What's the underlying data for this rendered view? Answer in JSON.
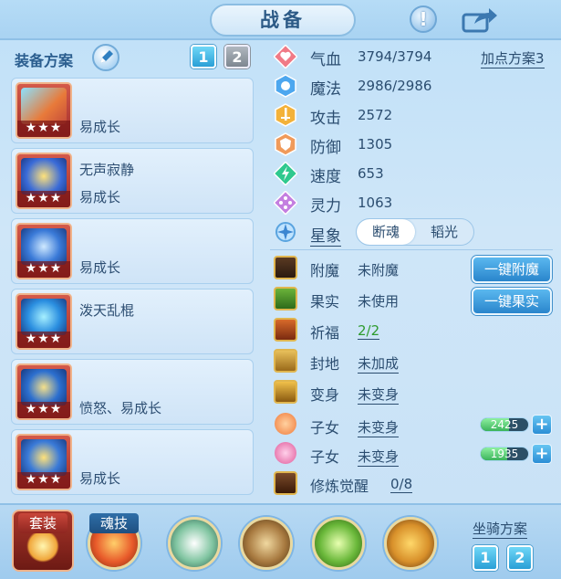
{
  "header": {
    "title": "战备",
    "hint_icon": "exclamation-icon",
    "share_icon": "share-icon"
  },
  "equip_panel": {
    "title": "装备方案",
    "plans": [
      "1",
      "2"
    ],
    "active_plan": "1",
    "items": [
      {
        "name": "",
        "attr": "易成长",
        "stars": "★★★",
        "icon": "ice-sword-icon"
      },
      {
        "name": "无声寂静",
        "attr": "易成长",
        "stars": "★★★",
        "icon": "golden-helmet-icon"
      },
      {
        "name": "",
        "attr": "易成长",
        "stars": "★★★",
        "icon": "blue-armor-icon"
      },
      {
        "name": "泼天乱棍",
        "attr": "",
        "stars": "★★★",
        "icon": "blue-staff-icon"
      },
      {
        "name": "",
        "attr": "愤怒、易成长",
        "stars": "★★★",
        "icon": "blue-necklace-icon"
      },
      {
        "name": "",
        "attr": "易成长",
        "stars": "★★★",
        "icon": "gold-boots-icon"
      }
    ]
  },
  "stats": {
    "add_point_plan": "加点方案3",
    "rows": [
      {
        "label": "气血",
        "value": "3794/3794",
        "icon": "heart-icon"
      },
      {
        "label": "魔法",
        "value": "2986/2986",
        "icon": "magic-icon"
      },
      {
        "label": "攻击",
        "value": "2572",
        "icon": "sword-icon"
      },
      {
        "label": "防御",
        "value": "1305",
        "icon": "shield-icon"
      },
      {
        "label": "速度",
        "value": "653",
        "icon": "speed-icon"
      },
      {
        "label": "灵力",
        "value": "1063",
        "icon": "spirit-icon"
      }
    ],
    "astro": {
      "label": "星象",
      "options": [
        "断魂",
        "韬光"
      ],
      "active": "断魂",
      "icon": "star-compass-icon"
    }
  },
  "extras": {
    "rows": [
      {
        "label": "附魔",
        "value": "未附魔",
        "style": "plain",
        "icon": "enchant-icon"
      },
      {
        "label": "果实",
        "value": "未使用",
        "style": "plain",
        "icon": "fruit-icon"
      },
      {
        "label": "祈福",
        "value": "2/2",
        "style": "green",
        "icon": "bless-icon"
      },
      {
        "label": "封地",
        "value": "未加成",
        "style": "underline",
        "icon": "fief-icon"
      },
      {
        "label": "变身",
        "value": "未变身",
        "style": "underline",
        "icon": "transform-icon"
      },
      {
        "label": "子女",
        "value": "未变身",
        "style": "underline",
        "icon": "child-icon-1",
        "bar_value": "2425",
        "bar_fill": 0.6
      },
      {
        "label": "子女",
        "value": "未变身",
        "style": "underline",
        "icon": "child-icon-2",
        "bar_value": "1935",
        "bar_fill": 0.55
      },
      {
        "label": "修炼觉醒",
        "value": "0/8",
        "style": "underline",
        "icon": "cultivation-icon"
      }
    ],
    "buttons": {
      "enchant": "一键附魔",
      "fruit": "一键果实"
    },
    "plus_label": "+"
  },
  "bottom": {
    "set_label": "套装",
    "soul_label": "魂技",
    "skills": [
      "sword-wave-skill-icon",
      "bow-skill-icon",
      "double-sword-skill-icon",
      "shadow-strike-skill-icon"
    ],
    "mount_title": "坐骑方案",
    "mount_plans": [
      "1",
      "2"
    ]
  }
}
